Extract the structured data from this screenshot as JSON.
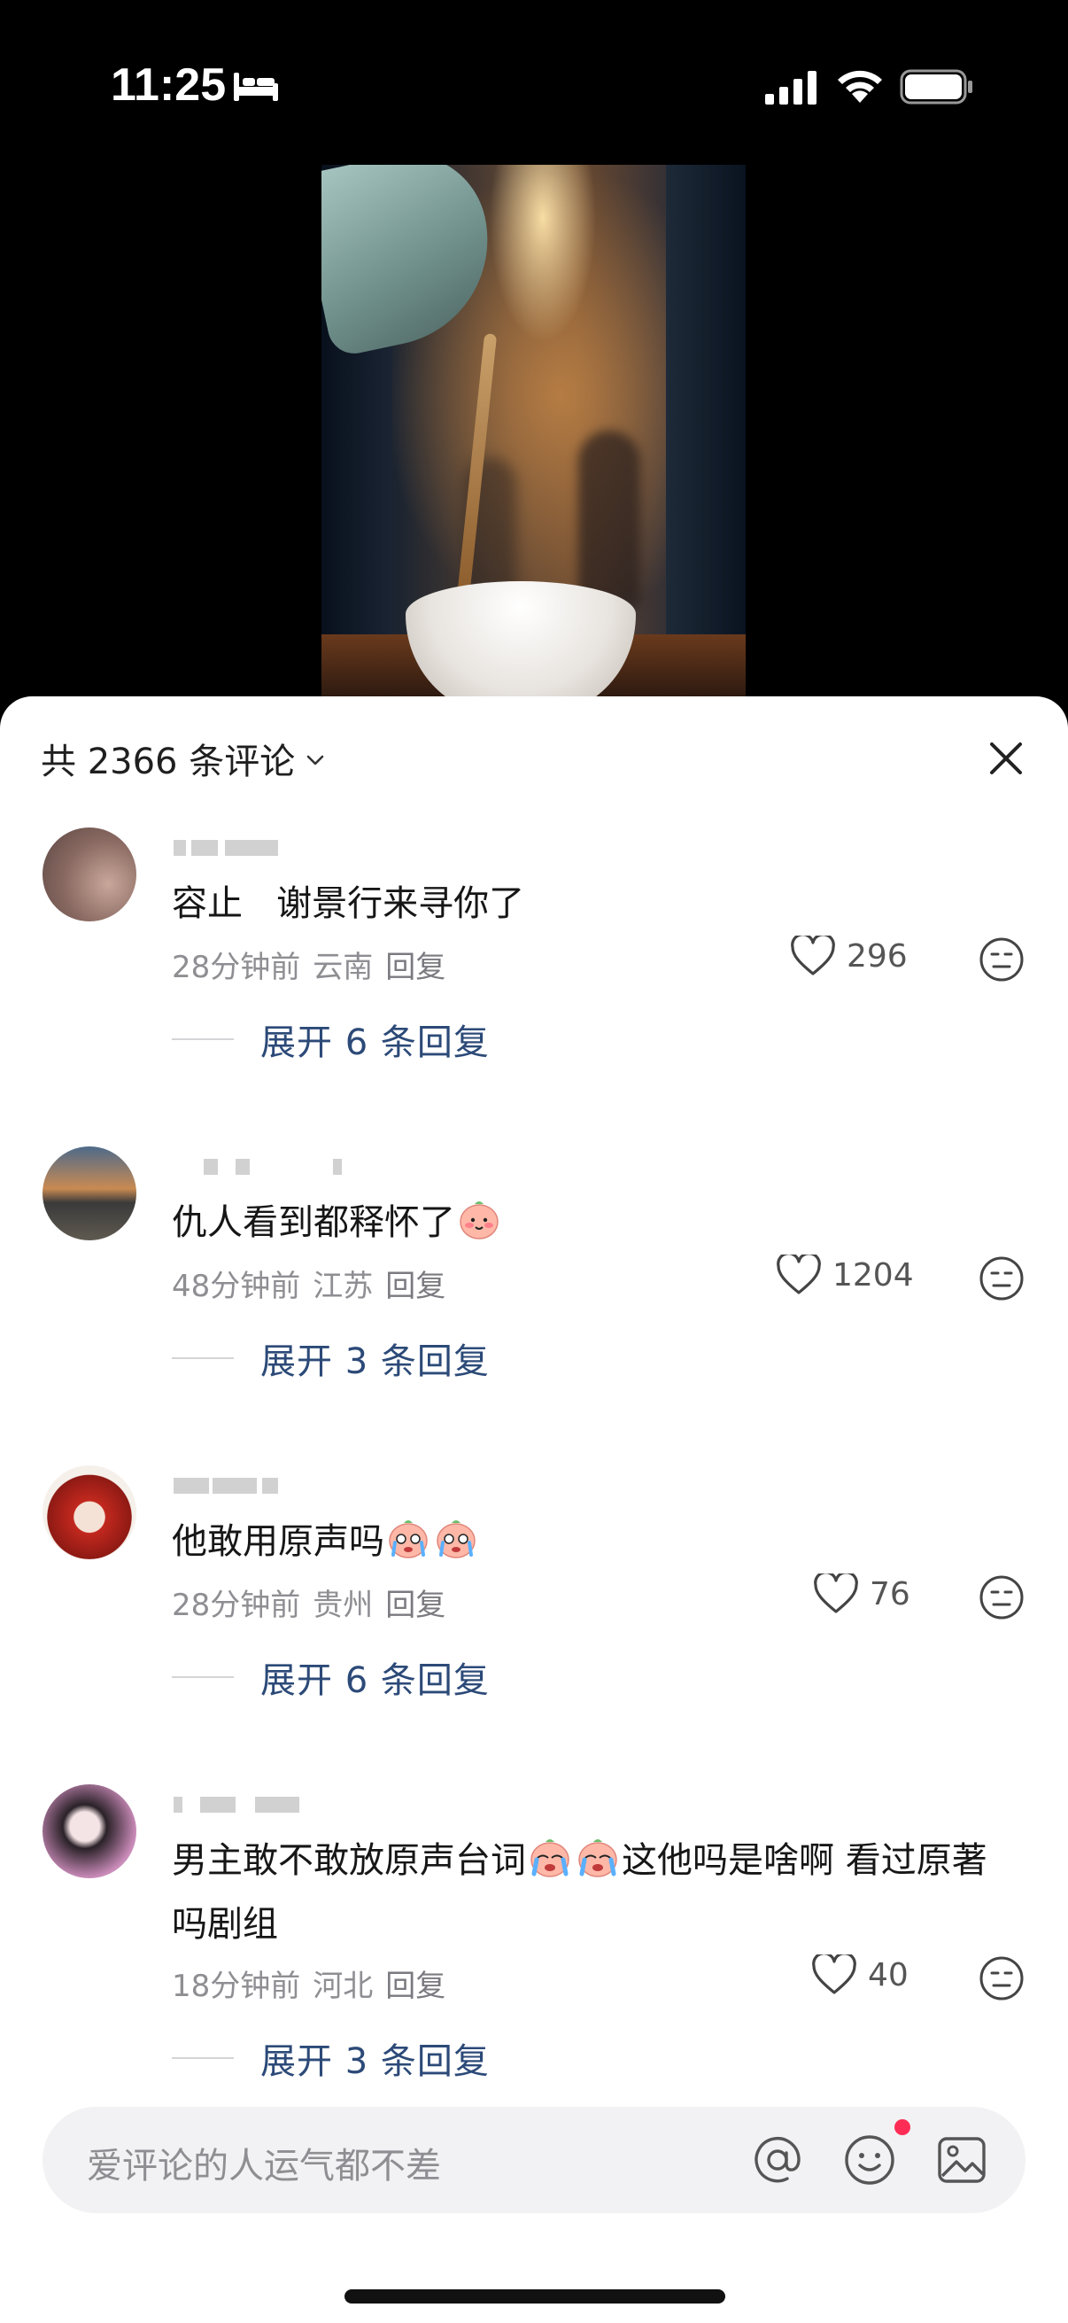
{
  "status_bar": {
    "time": "11:25",
    "icons": [
      "bed-icon",
      "signal-icon",
      "wifi-icon",
      "battery-icon"
    ]
  },
  "sheet": {
    "title": "共 2366 条评论",
    "close_icon": "close-icon"
  },
  "comments": [
    {
      "username": "",
      "text": "容止   谢景行来寻你了",
      "time": "28分钟前",
      "location": "云南",
      "reply_label": "回复",
      "likes": "296",
      "expand_label": "展开 6 条回复"
    },
    {
      "username": "",
      "text": "仇人看到都释怀了",
      "time": "48分钟前",
      "location": "江苏",
      "reply_label": "回复",
      "likes": "1204",
      "expand_label": "展开 3 条回复"
    },
    {
      "username": "",
      "text": "他敢用原声吗",
      "time": "28分钟前",
      "location": "贵州",
      "reply_label": "回复",
      "likes": "76",
      "expand_label": "展开 6 条回复"
    },
    {
      "username": "",
      "text_part1": "男主敢不敢放原声台词",
      "text_part2": "这他吗是啥啊 看过原著吗剧组",
      "time": "18分钟前",
      "location": "河北",
      "reply_label": "回复",
      "likes": "40",
      "expand_label": "展开 3 条回复"
    }
  ],
  "input": {
    "placeholder": "爱评论的人运气都不差",
    "icons": [
      "at-icon",
      "emoji-icon",
      "image-icon"
    ]
  },
  "colors": {
    "expand_link": "#2c4a78",
    "meta_text": "#8e8e93",
    "notification_dot": "#ff2d55"
  }
}
